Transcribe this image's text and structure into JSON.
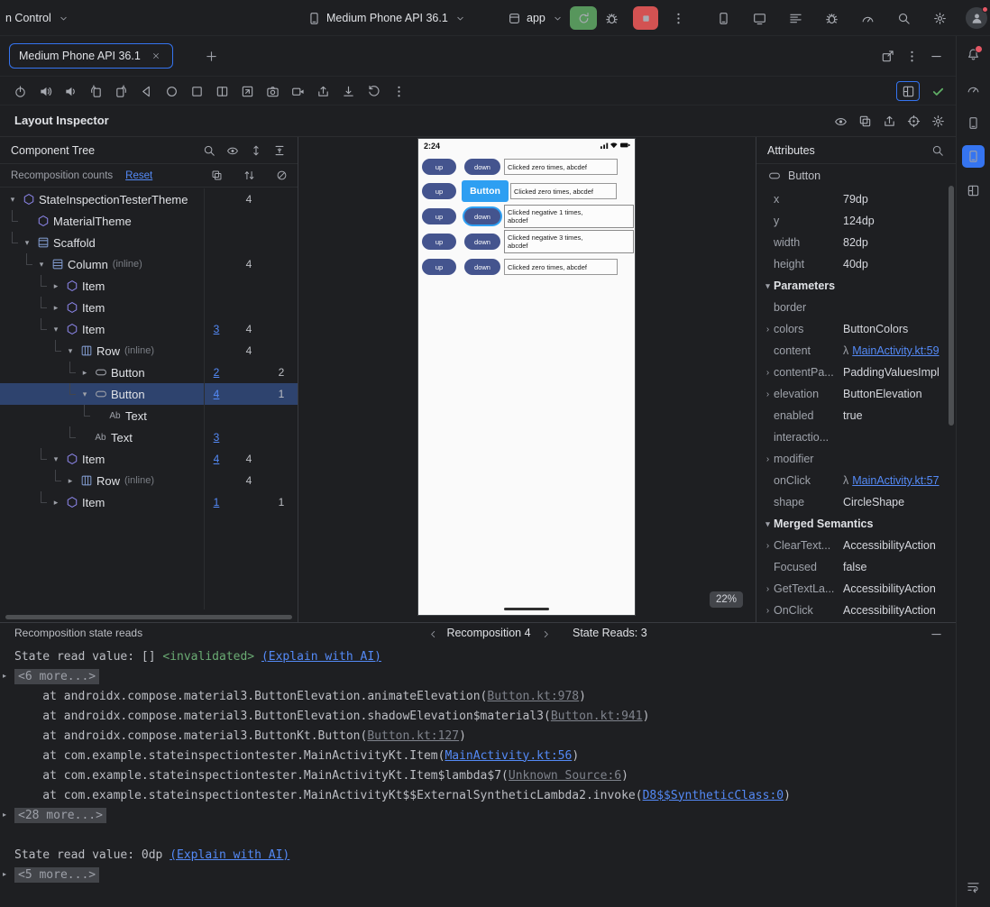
{
  "topbar": {
    "vcs": "n Control",
    "device": "Medium Phone API 36.1",
    "run_config": "app"
  },
  "tabs": {
    "active": "Medium Phone API 36.1"
  },
  "inspector": {
    "title": "Layout Inspector"
  },
  "icons": {
    "topbar_right": [
      "device-manager",
      "device-mirror",
      "logcat",
      "app-quality-insights",
      "profiler",
      "search",
      "settings"
    ],
    "tab_actions": [
      "open-in-window",
      "more",
      "hide"
    ],
    "emulator_toolbar": [
      "power",
      "volume-up",
      "volume-down",
      "rotate-left",
      "rotate-right",
      "back",
      "home",
      "overview",
      "fold",
      "resize",
      "screenshot",
      "screen-record",
      "share",
      "save",
      "restore",
      "more"
    ],
    "inspector_toolbar": [
      "live-updates",
      "snapshot",
      "export",
      "pick-target",
      "settings"
    ],
    "tree_toolbar": [
      "search",
      "visibility",
      "expand-all",
      "collapse-all"
    ],
    "counts_columns": [
      "counts",
      "sorter",
      "skips"
    ],
    "tool_strip": [
      "notifications",
      "profiler-tool",
      "device-explorer",
      "running-devices",
      "layout-inspector"
    ],
    "strip_bottom": [
      "soft-wrap"
    ]
  },
  "tree": {
    "title": "Component Tree",
    "counts_label": "Recomposition counts",
    "reset": "Reset",
    "rows": [
      {
        "label": "StateInspectionTesterTheme",
        "icon": "compose",
        "expander": "open",
        "depth": 0,
        "c2": "4"
      },
      {
        "label": "MaterialTheme",
        "icon": "compose",
        "depth": 1
      },
      {
        "label": "Scaffold",
        "icon": "scaffold",
        "expander": "open",
        "depth": 1
      },
      {
        "label": "Column",
        "suffix": "(inline)",
        "icon": "column",
        "expander": "open",
        "depth": 2,
        "c2": "4"
      },
      {
        "label": "Item",
        "icon": "compose",
        "expander": "closed",
        "depth": 3
      },
      {
        "label": "Item",
        "icon": "compose",
        "expander": "closed",
        "depth": 3
      },
      {
        "label": "Item",
        "icon": "compose",
        "expander": "open",
        "depth": 3,
        "c1": "3",
        "c2": "4"
      },
      {
        "label": "Row",
        "suffix": "(inline)",
        "icon": "row",
        "expander": "open",
        "depth": 4,
        "c2": "4"
      },
      {
        "label": "Button",
        "icon": "button",
        "expander": "closed",
        "depth": 5,
        "c1": "2",
        "c3": "2"
      },
      {
        "label": "Button",
        "icon": "button",
        "expander": "open",
        "depth": 5,
        "c1": "4",
        "c3": "1",
        "selected": true
      },
      {
        "label": "Text",
        "icon": "text",
        "depth": 6
      },
      {
        "label": "Text",
        "icon": "text",
        "depth": 5,
        "c1": "3"
      },
      {
        "label": "Item",
        "icon": "compose",
        "expander": "open",
        "depth": 3,
        "c1": "4",
        "c2": "4"
      },
      {
        "label": "Row",
        "suffix": "(inline)",
        "icon": "row",
        "expander": "closed",
        "depth": 4,
        "c2": "4"
      },
      {
        "label": "Item",
        "icon": "compose",
        "expander": "closed",
        "depth": 3,
        "c1": "1",
        "c3": "1"
      }
    ]
  },
  "device_screen": {
    "clock": "2:24",
    "zoom": "22%",
    "rows": [
      {
        "up": "up",
        "down": "down",
        "down_style": "pill",
        "lines": [
          "Clicked zero times, abcdef"
        ],
        "box_style": "thin"
      },
      {
        "up": "up",
        "down": "Button",
        "down_style": "selected",
        "lines": [
          "Clicked zero times, abcdef"
        ],
        "box_style": "thin2"
      },
      {
        "up": "up",
        "down": "down",
        "down_style": "highlight",
        "lines": [
          "Clicked negative 1 times,",
          "abcdef"
        ],
        "box_style": "bordered"
      },
      {
        "up": "up",
        "down": "down",
        "down_style": "pill",
        "lines": [
          "Clicked negative 3 times,",
          "abcdef"
        ],
        "box_style": "bordered"
      },
      {
        "up": "up",
        "down": "down",
        "down_style": "pill",
        "lines": [
          "Clicked zero times, abcdef"
        ],
        "box_style": "thin"
      }
    ]
  },
  "attributes": {
    "title": "Attributes",
    "component": "Button",
    "props": [
      {
        "name": "x",
        "value": "79dp"
      },
      {
        "name": "y",
        "value": "124dp"
      },
      {
        "name": "width",
        "value": "82dp"
      },
      {
        "name": "height",
        "value": "40dp"
      },
      {
        "type": "section",
        "name": "Parameters"
      },
      {
        "name": "border",
        "value": ""
      },
      {
        "name": "colors",
        "value": "ButtonColors",
        "expand": true
      },
      {
        "name": "content",
        "value": "MainActivity.kt:59",
        "link": true,
        "prefix": "λ"
      },
      {
        "name": "contentPa...",
        "value": "PaddingValuesImpl",
        "expand": true
      },
      {
        "name": "elevation",
        "value": "ButtonElevation",
        "expand": true
      },
      {
        "name": "enabled",
        "value": "true"
      },
      {
        "name": "interactio...",
        "value": ""
      },
      {
        "name": "modifier",
        "value": "",
        "expand": true
      },
      {
        "name": "onClick",
        "value": "MainActivity.kt:57",
        "link": true,
        "prefix": "λ"
      },
      {
        "name": "shape",
        "value": "CircleShape"
      },
      {
        "type": "section",
        "name": "Merged Semantics"
      },
      {
        "name": "ClearText...",
        "value": "AccessibilityAction",
        "expand": true
      },
      {
        "name": "Focused",
        "value": "false"
      },
      {
        "name": "GetTextLa...",
        "value": "AccessibilityAction",
        "expand": true
      },
      {
        "name": "OnClick",
        "value": "AccessibilityAction",
        "expand": true
      }
    ]
  },
  "bottom_bar": {
    "title": "Recomposition state reads",
    "nav": "Recomposition 4",
    "reads": "State Reads: 3"
  },
  "console": {
    "lines": [
      {
        "chunks": [
          {
            "t": "State read value: [] ",
            "c": "plain"
          },
          {
            "t": "<invalidated>",
            "c": "green"
          },
          {
            "t": " ",
            "c": "plain"
          },
          {
            "t": "(Explain with AI)",
            "c": "link"
          }
        ]
      },
      {
        "expander": true,
        "hl": true,
        "chunks": [
          {
            "t": "<6 more...>",
            "c": "dim"
          }
        ]
      },
      {
        "chunks": [
          {
            "t": "    at androidx.compose.material3.ButtonElevation.animateElevation(",
            "c": "plain"
          },
          {
            "t": "Button.kt:978",
            "c": "dimlink"
          },
          {
            "t": ")",
            "c": "plain"
          }
        ]
      },
      {
        "chunks": [
          {
            "t": "    at androidx.compose.material3.ButtonElevation.shadowElevation$material3(",
            "c": "plain"
          },
          {
            "t": "Button.kt:941",
            "c": "dimlink"
          },
          {
            "t": ")",
            "c": "plain"
          }
        ]
      },
      {
        "chunks": [
          {
            "t": "    at androidx.compose.material3.ButtonKt.Button(",
            "c": "plain"
          },
          {
            "t": "Button.kt:127",
            "c": "dimlink"
          },
          {
            "t": ")",
            "c": "plain"
          }
        ]
      },
      {
        "chunks": [
          {
            "t": "    at com.example.stateinspectiontester.MainActivityKt.Item(",
            "c": "plain"
          },
          {
            "t": "MainActivity.kt:56",
            "c": "link"
          },
          {
            "t": ")",
            "c": "plain"
          }
        ]
      },
      {
        "chunks": [
          {
            "t": "    at com.example.stateinspectiontester.MainActivityKt.Item$lambda$7(",
            "c": "plain"
          },
          {
            "t": "Unknown Source:6",
            "c": "dimlink"
          },
          {
            "t": ")",
            "c": "plain"
          }
        ]
      },
      {
        "chunks": [
          {
            "t": "    at com.example.stateinspectiontester.MainActivityKt$$ExternalSyntheticLambda2.invoke(",
            "c": "plain"
          },
          {
            "t": "D8$$SyntheticClass:0",
            "c": "link"
          },
          {
            "t": ")",
            "c": "plain"
          }
        ]
      },
      {
        "expander": true,
        "hl": true,
        "chunks": [
          {
            "t": "<28 more...>",
            "c": "dim"
          }
        ]
      },
      {
        "blank": true
      },
      {
        "chunks": [
          {
            "t": "State read value: 0dp ",
            "c": "plain"
          },
          {
            "t": "(Explain with AI)",
            "c": "link"
          }
        ]
      },
      {
        "expander": true,
        "hl": true,
        "chunks": [
          {
            "t": "<5 more...>",
            "c": "dim"
          }
        ]
      }
    ]
  }
}
